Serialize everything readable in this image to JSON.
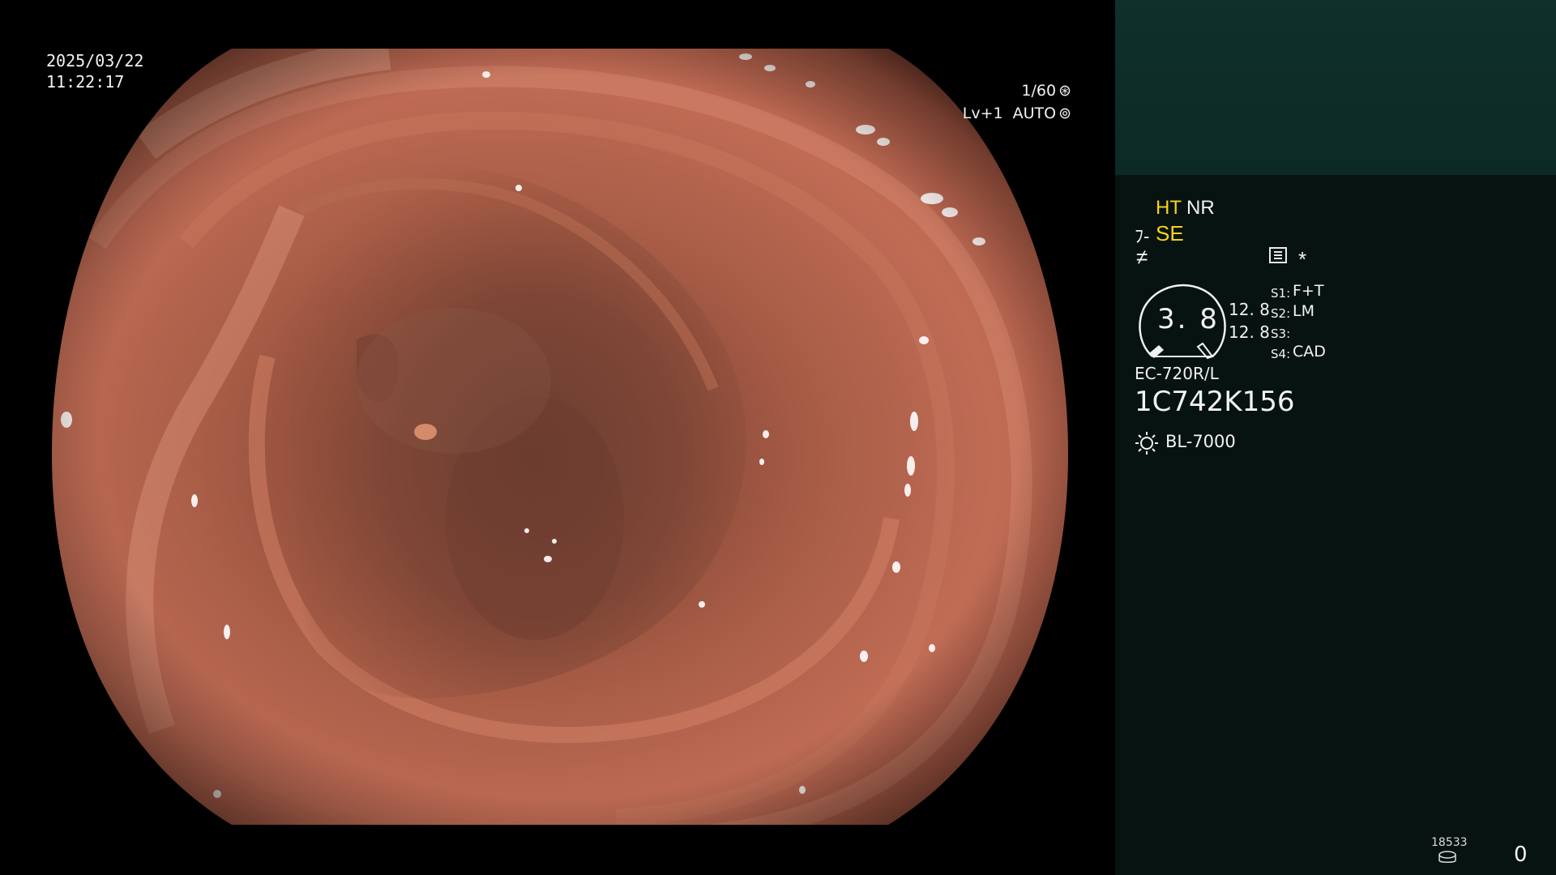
{
  "overlay": {
    "date": "2025/03/22",
    "time": "11:22:17",
    "shutter": "1/60",
    "shutter_icon": "aperture-icon",
    "level": "Lv+1",
    "mode": "AUTO",
    "mode_icon": "iris-icon"
  },
  "panel": {
    "ht": "HT",
    "nr": "NR",
    "se": "SE",
    "se_icon": "structure-enhance-icon",
    "f_icon": "not-equal-icon",
    "menu_icon": "menu-list-icon",
    "star": "*",
    "gauge_value": "3. 8",
    "value_1": "12. 8",
    "value_2": "12. 8",
    "switches": [
      {
        "key": "S1:",
        "value": "F+T"
      },
      {
        "key": "S2:",
        "value": "LM"
      },
      {
        "key": "S3:",
        "value": ""
      },
      {
        "key": "S4:",
        "value": "CAD"
      }
    ],
    "scope_model": "EC-720R/L",
    "scope_serial": "1C742K156",
    "light_icon": "sun-icon",
    "light_source": "BL-7000",
    "counter": "18533",
    "disk_icon": "disk-icon",
    "count_right": "0"
  },
  "colors": {
    "panel_background": "#071311",
    "panel_top_background": "#0f302b",
    "highlight_yellow": "#f5d21c",
    "tissue": "#b4604a"
  }
}
